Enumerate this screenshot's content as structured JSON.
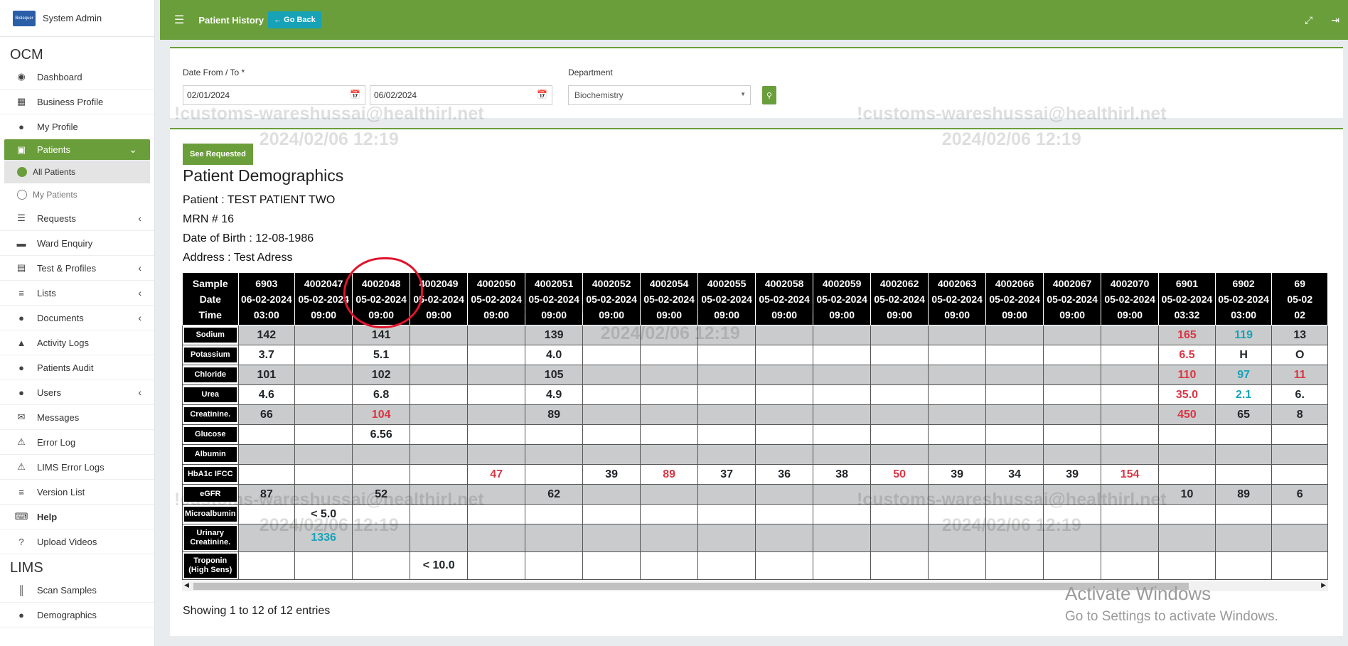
{
  "sidebar": {
    "user": "System Admin",
    "logo_text": "Biolequer",
    "section_ocm": "OCM",
    "section_lims": "LIMS",
    "items": [
      {
        "label": "Dashboard",
        "icon": "dashboard-icon"
      },
      {
        "label": "Business Profile",
        "icon": "building-icon"
      },
      {
        "label": "My Profile",
        "icon": "user-icon"
      },
      {
        "label": "Patients",
        "icon": "patients-icon",
        "active": true
      },
      {
        "label": "Requests",
        "icon": "database-icon"
      },
      {
        "label": "Ward Enquiry",
        "icon": "bed-icon"
      },
      {
        "label": "Test & Profiles",
        "icon": "clipboard-icon"
      },
      {
        "label": "Lists",
        "icon": "list-icon"
      },
      {
        "label": "Documents",
        "icon": "users-icon"
      },
      {
        "label": "Activity Logs",
        "icon": "bank-icon"
      },
      {
        "label": "Patients Audit",
        "icon": "users-icon"
      },
      {
        "label": "Users",
        "icon": "users-icon"
      },
      {
        "label": "Messages",
        "icon": "envelope-icon"
      },
      {
        "label": "Error Log",
        "icon": "warning-icon"
      },
      {
        "label": "LIMS Error Logs",
        "icon": "warning-icon"
      },
      {
        "label": "Version List",
        "icon": "list-icon"
      },
      {
        "label": "Help",
        "icon": "keyboard-icon"
      },
      {
        "label": "Upload Videos",
        "icon": "question-icon"
      }
    ],
    "patients_sub": [
      "All Patients",
      "My Patients"
    ],
    "lims_items": [
      {
        "label": "Scan Samples",
        "icon": "barcode-icon"
      },
      {
        "label": "Demographics",
        "icon": "user-icon"
      }
    ]
  },
  "topbar": {
    "title": "Patient History",
    "go_back": "Go Back"
  },
  "filters": {
    "date_label": "Date From / To *",
    "date_from": "02/01/2024",
    "date_to": "06/02/2024",
    "department_label": "Department",
    "department_value": "Biochemistry"
  },
  "main": {
    "see_requested": "See Requested",
    "title": "Patient Demographics",
    "patient": "Patient : TEST PATIENT TWO",
    "mrn": "MRN # 16",
    "dob": "Date of Birth : 12-08-1986",
    "address": "Address : Test Adress",
    "showing": "Showing 1 to 12 of 12 entries"
  },
  "table": {
    "header_first": [
      "Sample",
      "Date",
      "Time"
    ],
    "columns": [
      [
        "6903",
        "06-02-2024",
        "03:00"
      ],
      [
        "4002047",
        "05-02-2024",
        "09:00"
      ],
      [
        "4002048",
        "05-02-2024",
        "09:00"
      ],
      [
        "4002049",
        "05-02-2024",
        "09:00"
      ],
      [
        "4002050",
        "05-02-2024",
        "09:00"
      ],
      [
        "4002051",
        "05-02-2024",
        "09:00"
      ],
      [
        "4002052",
        "05-02-2024",
        "09:00"
      ],
      [
        "4002054",
        "05-02-2024",
        "09:00"
      ],
      [
        "4002055",
        "05-02-2024",
        "09:00"
      ],
      [
        "4002058",
        "05-02-2024",
        "09:00"
      ],
      [
        "4002059",
        "05-02-2024",
        "09:00"
      ],
      [
        "4002062",
        "05-02-2024",
        "09:00"
      ],
      [
        "4002063",
        "05-02-2024",
        "09:00"
      ],
      [
        "4002066",
        "05-02-2024",
        "09:00"
      ],
      [
        "4002067",
        "05-02-2024",
        "09:00"
      ],
      [
        "4002070",
        "05-02-2024",
        "09:00"
      ],
      [
        "6901",
        "05-02-2024",
        "03:32"
      ],
      [
        "6902",
        "05-02-2024",
        "03:00"
      ],
      [
        "69",
        "05-02",
        "02"
      ]
    ],
    "rows": [
      {
        "label": "Sodium",
        "cells": [
          [
            "142",
            ""
          ],
          [
            "",
            ""
          ],
          [
            "141",
            ""
          ],
          [
            "",
            ""
          ],
          [
            "",
            ""
          ],
          [
            "139",
            ""
          ],
          [
            "",
            ""
          ],
          [
            "",
            ""
          ],
          [
            "",
            ""
          ],
          [
            "",
            ""
          ],
          [
            "",
            ""
          ],
          [
            "",
            ""
          ],
          [
            "",
            ""
          ],
          [
            "",
            ""
          ],
          [
            "",
            ""
          ],
          [
            "",
            ""
          ],
          [
            "165",
            "red"
          ],
          [
            "119",
            "blue"
          ],
          [
            "13",
            ""
          ]
        ]
      },
      {
        "label": "Potassium",
        "cells": [
          [
            "3.7",
            ""
          ],
          [
            "",
            ""
          ],
          [
            "5.1",
            ""
          ],
          [
            "",
            ""
          ],
          [
            "",
            ""
          ],
          [
            "4.0",
            ""
          ],
          [
            "",
            ""
          ],
          [
            "",
            ""
          ],
          [
            "",
            ""
          ],
          [
            "",
            ""
          ],
          [
            "",
            ""
          ],
          [
            "",
            ""
          ],
          [
            "",
            ""
          ],
          [
            "",
            ""
          ],
          [
            "",
            ""
          ],
          [
            "",
            ""
          ],
          [
            "6.5",
            "red"
          ],
          [
            "H",
            ""
          ],
          [
            "O",
            ""
          ]
        ]
      },
      {
        "label": "Chloride",
        "cells": [
          [
            "101",
            ""
          ],
          [
            "",
            ""
          ],
          [
            "102",
            ""
          ],
          [
            "",
            ""
          ],
          [
            "",
            ""
          ],
          [
            "105",
            ""
          ],
          [
            "",
            ""
          ],
          [
            "",
            ""
          ],
          [
            "",
            ""
          ],
          [
            "",
            ""
          ],
          [
            "",
            ""
          ],
          [
            "",
            ""
          ],
          [
            "",
            ""
          ],
          [
            "",
            ""
          ],
          [
            "",
            ""
          ],
          [
            "",
            ""
          ],
          [
            "110",
            "red"
          ],
          [
            "97",
            "blue"
          ],
          [
            "11",
            "red"
          ]
        ]
      },
      {
        "label": "Urea",
        "cells": [
          [
            "4.6",
            ""
          ],
          [
            "",
            ""
          ],
          [
            "6.8",
            ""
          ],
          [
            "",
            ""
          ],
          [
            "",
            ""
          ],
          [
            "4.9",
            ""
          ],
          [
            "",
            ""
          ],
          [
            "",
            ""
          ],
          [
            "",
            ""
          ],
          [
            "",
            ""
          ],
          [
            "",
            ""
          ],
          [
            "",
            ""
          ],
          [
            "",
            ""
          ],
          [
            "",
            ""
          ],
          [
            "",
            ""
          ],
          [
            "",
            ""
          ],
          [
            "35.0",
            "red"
          ],
          [
            "2.1",
            "blue"
          ],
          [
            "6.",
            ""
          ]
        ]
      },
      {
        "label": "Creatinine.",
        "cells": [
          [
            "66",
            ""
          ],
          [
            "",
            ""
          ],
          [
            "104",
            "red"
          ],
          [
            "",
            ""
          ],
          [
            "",
            ""
          ],
          [
            "89",
            ""
          ],
          [
            "",
            ""
          ],
          [
            "",
            ""
          ],
          [
            "",
            ""
          ],
          [
            "",
            ""
          ],
          [
            "",
            ""
          ],
          [
            "",
            ""
          ],
          [
            "",
            ""
          ],
          [
            "",
            ""
          ],
          [
            "",
            ""
          ],
          [
            "",
            ""
          ],
          [
            "450",
            "red"
          ],
          [
            "65",
            ""
          ],
          [
            "8",
            ""
          ]
        ]
      },
      {
        "label": "Glucose",
        "cells": [
          [
            "",
            ""
          ],
          [
            "",
            ""
          ],
          [
            "6.56",
            ""
          ],
          [
            "",
            ""
          ],
          [
            "",
            ""
          ],
          [
            "",
            ""
          ],
          [
            "",
            ""
          ],
          [
            "",
            ""
          ],
          [
            "",
            ""
          ],
          [
            "",
            ""
          ],
          [
            "",
            ""
          ],
          [
            "",
            ""
          ],
          [
            "",
            ""
          ],
          [
            "",
            ""
          ],
          [
            "",
            ""
          ],
          [
            "",
            ""
          ],
          [
            "",
            ""
          ],
          [
            "",
            ""
          ],
          [
            "",
            ""
          ]
        ]
      },
      {
        "label": "Albumin",
        "cells": [
          [
            "",
            ""
          ],
          [
            "",
            ""
          ],
          [
            "",
            ""
          ],
          [
            "",
            ""
          ],
          [
            "",
            ""
          ],
          [
            "",
            ""
          ],
          [
            "",
            ""
          ],
          [
            "",
            ""
          ],
          [
            "",
            ""
          ],
          [
            "",
            ""
          ],
          [
            "",
            ""
          ],
          [
            "",
            ""
          ],
          [
            "",
            ""
          ],
          [
            "",
            ""
          ],
          [
            "",
            ""
          ],
          [
            "",
            ""
          ],
          [
            "",
            ""
          ],
          [
            "",
            ""
          ],
          [
            "",
            ""
          ]
        ]
      },
      {
        "label": "HbA1c IFCC",
        "cells": [
          [
            "",
            ""
          ],
          [
            "",
            ""
          ],
          [
            "",
            ""
          ],
          [
            "",
            ""
          ],
          [
            "47",
            "red"
          ],
          [
            "",
            ""
          ],
          [
            "39",
            ""
          ],
          [
            "89",
            "red"
          ],
          [
            "37",
            ""
          ],
          [
            "36",
            ""
          ],
          [
            "38",
            ""
          ],
          [
            "50",
            "red"
          ],
          [
            "39",
            ""
          ],
          [
            "34",
            ""
          ],
          [
            "39",
            ""
          ],
          [
            "154",
            "red"
          ],
          [
            "",
            ""
          ],
          [
            "",
            ""
          ],
          [
            "",
            ""
          ]
        ]
      },
      {
        "label": "eGFR",
        "cells": [
          [
            "87",
            ""
          ],
          [
            "",
            ""
          ],
          [
            "52",
            ""
          ],
          [
            "",
            ""
          ],
          [
            "",
            ""
          ],
          [
            "62",
            ""
          ],
          [
            "",
            ""
          ],
          [
            "",
            ""
          ],
          [
            "",
            ""
          ],
          [
            "",
            ""
          ],
          [
            "",
            ""
          ],
          [
            "",
            ""
          ],
          [
            "",
            ""
          ],
          [
            "",
            ""
          ],
          [
            "",
            ""
          ],
          [
            "",
            ""
          ],
          [
            "10",
            ""
          ],
          [
            "89",
            ""
          ],
          [
            "6",
            ""
          ]
        ]
      },
      {
        "label": "Microalbumin",
        "cells": [
          [
            "",
            ""
          ],
          [
            "< 5.0",
            ""
          ],
          [
            "",
            ""
          ],
          [
            "",
            ""
          ],
          [
            "",
            ""
          ],
          [
            "",
            ""
          ],
          [
            "",
            ""
          ],
          [
            "",
            ""
          ],
          [
            "",
            ""
          ],
          [
            "",
            ""
          ],
          [
            "",
            ""
          ],
          [
            "",
            ""
          ],
          [
            "",
            ""
          ],
          [
            "",
            ""
          ],
          [
            "",
            ""
          ],
          [
            "",
            ""
          ],
          [
            "",
            ""
          ],
          [
            "",
            ""
          ],
          [
            "",
            ""
          ]
        ]
      },
      {
        "label": "Urinary Creatinine.",
        "cells": [
          [
            "",
            ""
          ],
          [
            "1336",
            "blue"
          ],
          [
            "",
            ""
          ],
          [
            "",
            ""
          ],
          [
            "",
            ""
          ],
          [
            "",
            ""
          ],
          [
            "",
            ""
          ],
          [
            "",
            ""
          ],
          [
            "",
            ""
          ],
          [
            "",
            ""
          ],
          [
            "",
            ""
          ],
          [
            "",
            ""
          ],
          [
            "",
            ""
          ],
          [
            "",
            ""
          ],
          [
            "",
            ""
          ],
          [
            "",
            ""
          ],
          [
            "",
            ""
          ],
          [
            "",
            ""
          ],
          [
            "",
            ""
          ]
        ]
      },
      {
        "label": "Troponin (High Sens)",
        "cells": [
          [
            "",
            ""
          ],
          [
            "",
            ""
          ],
          [
            "",
            ""
          ],
          [
            "< 10.0",
            ""
          ],
          [
            "",
            ""
          ],
          [
            "",
            ""
          ],
          [
            "",
            ""
          ],
          [
            "",
            ""
          ],
          [
            "",
            ""
          ],
          [
            "",
            ""
          ],
          [
            "",
            ""
          ],
          [
            "",
            ""
          ],
          [
            "",
            ""
          ],
          [
            "",
            ""
          ],
          [
            "",
            ""
          ],
          [
            "",
            ""
          ],
          [
            "",
            ""
          ],
          [
            "",
            ""
          ],
          [
            "",
            ""
          ]
        ]
      }
    ]
  },
  "watermark": {
    "email": "!customs-wareshussai@healthirl.net",
    "timestamp": "2024/02/06 12:19"
  },
  "windows": {
    "activate_title": "Activate Windows",
    "activate_sub": "Go to Settings to activate Windows."
  },
  "colors": {
    "brand": "#6a9e3a",
    "accent": "#17a2b8",
    "alert": "#dc3545"
  }
}
